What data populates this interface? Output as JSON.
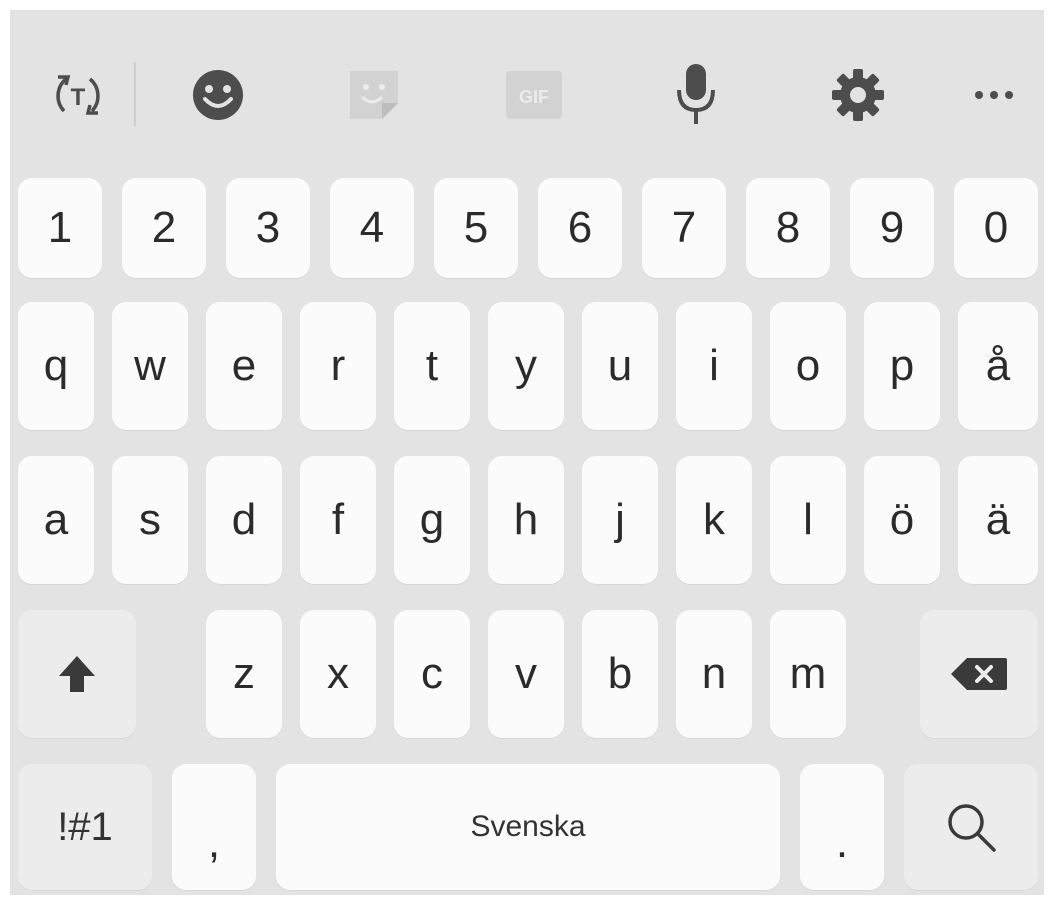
{
  "toolbar": {
    "items": [
      {
        "name": "translate-icon"
      },
      {
        "name": "emoji-icon"
      },
      {
        "name": "sticker-icon"
      },
      {
        "name": "gif-icon",
        "label": "GIF"
      },
      {
        "name": "microphone-icon"
      },
      {
        "name": "settings-gear-icon"
      },
      {
        "name": "more-options-icon",
        "label": "···"
      }
    ]
  },
  "keys": {
    "row1": [
      "1",
      "2",
      "3",
      "4",
      "5",
      "6",
      "7",
      "8",
      "9",
      "0"
    ],
    "row2": [
      "q",
      "w",
      "e",
      "r",
      "t",
      "y",
      "u",
      "i",
      "o",
      "p",
      "å"
    ],
    "row3": [
      "a",
      "s",
      "d",
      "f",
      "g",
      "h",
      "j",
      "k",
      "l",
      "ö",
      "ä"
    ],
    "row4": [
      "z",
      "x",
      "c",
      "v",
      "b",
      "n",
      "m"
    ]
  },
  "bottom": {
    "symbols": "!#1",
    "comma": ",",
    "space": "Svenska",
    "period": "."
  },
  "colors": {
    "background": "#e3e3e3",
    "key": "#fbfbfb",
    "icon": "#4d4d4d",
    "icon_disabled": "#d2d2d2"
  }
}
